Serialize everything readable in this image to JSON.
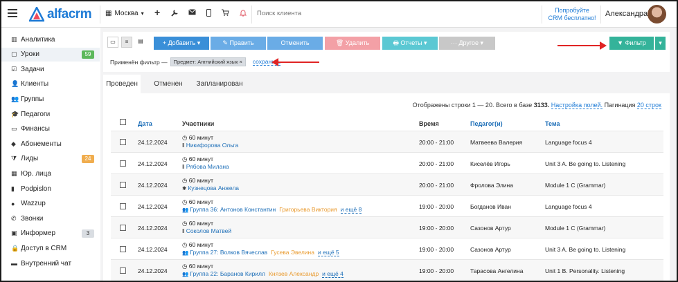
{
  "app": {
    "logo_text": "alfacrm",
    "city": "Москва",
    "search_placeholder": "Поиск клиента",
    "promo_line1": "Попробуйте",
    "promo_line2": "CRM бесплатно!",
    "user_name": "Александра"
  },
  "sidebar": {
    "items": [
      {
        "label": "Аналитика",
        "icon": "chart-icon"
      },
      {
        "label": "Уроки",
        "icon": "lesson-icon",
        "badge": "59",
        "badge_color": "#5cb85c"
      },
      {
        "label": "Задачи",
        "icon": "tasks-icon"
      },
      {
        "label": "Клиенты",
        "icon": "user-icon"
      },
      {
        "label": "Группы",
        "icon": "users-icon"
      },
      {
        "label": "Педагоги",
        "icon": "graduation-cap-icon"
      },
      {
        "label": "Финансы",
        "icon": "money-icon"
      },
      {
        "label": "Абонементы",
        "icon": "tag-icon"
      },
      {
        "label": "Лиды",
        "icon": "funnel-icon",
        "badge": "24",
        "badge_color": "#f0ad4e"
      },
      {
        "label": "Юр. лица",
        "icon": "building-icon"
      },
      {
        "label": "Podpislon",
        "icon": "document-icon"
      },
      {
        "label": "Wazzup",
        "icon": "whatsapp-icon"
      },
      {
        "label": "Звонки",
        "icon": "phone-icon"
      },
      {
        "label": "Информер",
        "icon": "informer-icon",
        "badge": "3",
        "badge_color": "#d9dde2"
      },
      {
        "label": "Доступ в CRM",
        "icon": "lock-icon"
      },
      {
        "label": "Внутренний чат",
        "icon": "chat-icon"
      }
    ]
  },
  "toolbar": {
    "add": "+ Добавить ▾",
    "edit": "✎ Править",
    "cancel": "Отменить",
    "delete": "🗑 Удалить",
    "reports": "🖶 Отчеты ▾",
    "other": "··· Другое ▾",
    "filter": "▼ Фильтр",
    "filter_caret": "▾",
    "colors": {
      "primary": "#3a8fd8",
      "light": "#6aace6",
      "danger": "#f3a0a6",
      "info": "#5bc8d3",
      "muted": "#c8c8c8",
      "success": "#34b39a"
    }
  },
  "filter": {
    "applied_label": "Применён фильтр —",
    "tag": "Предмет: Английский язык ×",
    "save": "сохранить"
  },
  "tabs": [
    {
      "label": "Проведен"
    },
    {
      "label": "Отменен"
    },
    {
      "label": "Запланирован"
    }
  ],
  "grid": {
    "info_prefix": "Отображены строки 1 — 20. Всего в базе ",
    "info_total": "3133.",
    "fields_link": "Настройка полей.",
    "pagination_label": "Пагинация",
    "pagination_link": "20 строк",
    "headers": {
      "date": "Дата",
      "participants": "Участники",
      "time": "Время",
      "teacher": "Педагог(и)",
      "topic": "Тема"
    },
    "rows": [
      {
        "date": "24.12.2024",
        "duration": "◷ 60 минут",
        "participant": "Никифорова Ольга",
        "participant_icon": "pause-icon",
        "extra": "",
        "more": "",
        "time": "20:00 - 21:00",
        "teacher": "Матвеева Валерия",
        "topic": "Language focus 4"
      },
      {
        "date": "24.12.2024",
        "duration": "◷ 60 минут",
        "participant": "Рябова Милана",
        "participant_icon": "pause-icon",
        "extra": "",
        "more": "",
        "time": "20:00 - 21:00",
        "teacher": "Киселёв Игорь",
        "topic": "Unit 3 A. Be going to. Listening"
      },
      {
        "date": "24.12.2024",
        "duration": "◷ 60 минут",
        "participant": "Кузнецова Анжела",
        "participant_icon": "snowflake-icon",
        "extra": "",
        "more": "",
        "time": "20:00 - 21:00",
        "teacher": "Фролова Элина",
        "topic": "Module 1 C (Grammar)"
      },
      {
        "date": "24.12.2024",
        "duration": "◷ 60 минут",
        "participant": "Группа 36: Антонов Константин",
        "participant_icon": "group-icon",
        "extra": "Григорьева Виктория",
        "more": "и ещё 8",
        "time": "19:00 - 20:00",
        "teacher": "Богданов Иван",
        "topic": "Language focus 4"
      },
      {
        "date": "24.12.2024",
        "duration": "◷ 60 минут",
        "participant": "Соколов Матвей",
        "participant_icon": "pause-icon",
        "extra": "",
        "more": "",
        "time": "19:00 - 20:00",
        "teacher": "Сазонов Артур",
        "topic": "Module 1 C (Grammar)"
      },
      {
        "date": "24.12.2024",
        "duration": "◷ 60 минут",
        "participant": "Группа 27: Волков Вячеслав",
        "participant_icon": "group-icon",
        "extra": "Гусева Эвелина",
        "more": "и ещё 5",
        "time": "19:00 - 20:00",
        "teacher": "Сазонов Артур",
        "topic": "Unit 3 A. Be going to. Listening"
      },
      {
        "date": "24.12.2024",
        "duration": "◷ 60 минут",
        "participant": "Группа 22: Баранов Кирилл",
        "participant_icon": "group-icon",
        "extra": "Князев Александр",
        "more": "и ещё 4",
        "time": "19:00 - 20:00",
        "teacher": "Тарасова Ангелина",
        "topic": "Unit 1 B. Personality. Listening"
      }
    ]
  }
}
